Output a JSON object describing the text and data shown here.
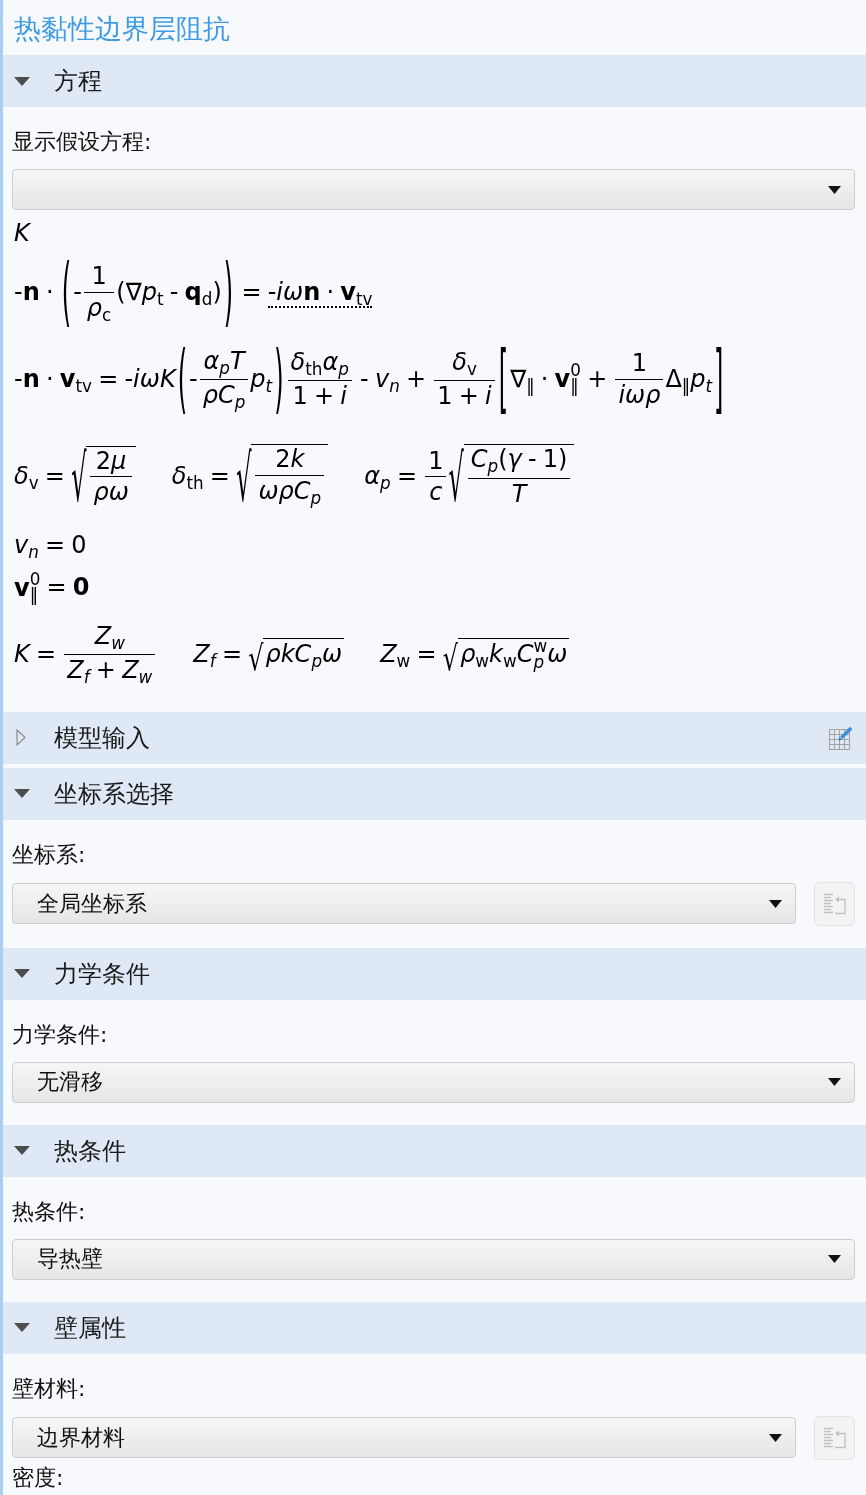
{
  "title": "热黏性边界层阻抗",
  "sections": [
    {
      "title": "方程",
      "expanded": true,
      "fields": [
        {
          "kind": "dropdown",
          "label": "显示假设方程:"
        }
      ],
      "equations": [
        {
          "parts": [
            [
              {
                "kind": "var",
                "text": "K"
              }
            ]
          ]
        },
        {
          "parts": [
            [
              {
                "kind": "op",
                "text": "-"
              },
              {
                "kind": "vec",
                "text": "n"
              },
              {
                "kind": "op",
                "text": " · "
              },
              {
                "kind": "fence",
                "open": "(",
                "close": ")",
                "body": [
                  {
                    "kind": "op",
                    "text": "-"
                  },
                  {
                    "kind": "frac",
                    "numerator": [
                      {
                        "kind": "op",
                        "text": "1"
                      }
                    ],
                    "denominator": [
                      {
                        "kind": "var",
                        "text": "ρ",
                        "sub": [
                          {
                            "kind": "op",
                            "text": "c"
                          }
                        ]
                      }
                    ]
                  },
                  {
                    "kind": "op",
                    "text": "(∇"
                  },
                  {
                    "kind": "var",
                    "text": "p",
                    "sub": [
                      {
                        "kind": "op",
                        "text": "t"
                      }
                    ]
                  },
                  {
                    "kind": "op",
                    "text": " - "
                  },
                  {
                    "kind": "vec",
                    "text": "q",
                    "sub": [
                      {
                        "kind": "op",
                        "text": "d"
                      }
                    ]
                  },
                  {
                    "kind": "op",
                    "text": ")"
                  }
                ]
              },
              {
                "kind": "op",
                "text": " = "
              },
              {
                "kind": "dotted",
                "body": [
                  {
                    "kind": "op",
                    "text": "-"
                  },
                  {
                    "kind": "var",
                    "text": "iω"
                  },
                  {
                    "kind": "vec",
                    "text": "n"
                  },
                  {
                    "kind": "op",
                    "text": " · "
                  },
                  {
                    "kind": "vec",
                    "text": "v",
                    "sub": [
                      {
                        "kind": "op",
                        "text": "tv"
                      }
                    ]
                  }
                ]
              }
            ]
          ]
        },
        {
          "parts": [
            [
              {
                "kind": "op",
                "text": "-"
              },
              {
                "kind": "vec",
                "text": "n"
              },
              {
                "kind": "op",
                "text": " · "
              },
              {
                "kind": "vec",
                "text": "v",
                "sub": [
                  {
                    "kind": "op",
                    "text": "tv"
                  }
                ]
              },
              {
                "kind": "op",
                "text": " = -"
              },
              {
                "kind": "var",
                "text": "iωK"
              },
              {
                "kind": "fence",
                "open": "(",
                "close": ")",
                "body": [
                  {
                    "kind": "op",
                    "text": "-"
                  },
                  {
                    "kind": "frac",
                    "numerator": [
                      {
                        "kind": "var",
                        "text": "α",
                        "sub": [
                          {
                            "kind": "var",
                            "text": "p"
                          }
                        ]
                      },
                      {
                        "kind": "var",
                        "text": "T"
                      }
                    ],
                    "denominator": [
                      {
                        "kind": "var",
                        "text": "ρC",
                        "sub": [
                          {
                            "kind": "var",
                            "text": "p"
                          }
                        ]
                      }
                    ]
                  },
                  {
                    "kind": "var",
                    "text": "p",
                    "sub": [
                      {
                        "kind": "var",
                        "text": "t"
                      }
                    ]
                  }
                ]
              },
              {
                "kind": "frac",
                "numerator": [
                  {
                    "kind": "var",
                    "text": "δ",
                    "sub": [
                      {
                        "kind": "op",
                        "text": "th"
                      }
                    ]
                  },
                  {
                    "kind": "var",
                    "text": "α",
                    "sub": [
                      {
                        "kind": "var",
                        "text": "p"
                      }
                    ]
                  }
                ],
                "denominator": [
                  {
                    "kind": "op",
                    "text": "1 + "
                  },
                  {
                    "kind": "var",
                    "text": "i"
                  }
                ]
              },
              {
                "kind": "op",
                "text": " - "
              },
              {
                "kind": "var",
                "text": "v",
                "sub": [
                  {
                    "kind": "var",
                    "text": "n"
                  }
                ]
              },
              {
                "kind": "op",
                "text": " + "
              },
              {
                "kind": "frac",
                "numerator": [
                  {
                    "kind": "var",
                    "text": "δ",
                    "sub": [
                      {
                        "kind": "op",
                        "text": "v"
                      }
                    ]
                  }
                ],
                "denominator": [
                  {
                    "kind": "op",
                    "text": "1 + "
                  },
                  {
                    "kind": "var",
                    "text": "i"
                  }
                ]
              },
              {
                "kind": "fence",
                "open": "[",
                "close": "]",
                "body": [
                  {
                    "kind": "op",
                    "text": "∇",
                    "sub": [
                      {
                        "kind": "op",
                        "text": "‖"
                      }
                    ]
                  },
                  {
                    "kind": "op",
                    "text": " · "
                  },
                  {
                    "kind": "vec",
                    "text": "v",
                    "sup": [
                      {
                        "kind": "op",
                        "text": "0"
                      }
                    ],
                    "sub": [
                      {
                        "kind": "op",
                        "text": "‖"
                      }
                    ]
                  },
                  {
                    "kind": "op",
                    "text": " + "
                  },
                  {
                    "kind": "frac",
                    "numerator": [
                      {
                        "kind": "op",
                        "text": "1"
                      }
                    ],
                    "denominator": [
                      {
                        "kind": "var",
                        "text": "iωρ"
                      }
                    ]
                  },
                  {
                    "kind": "op",
                    "text": "Δ",
                    "sub": [
                      {
                        "kind": "op",
                        "text": "‖"
                      }
                    ]
                  },
                  {
                    "kind": "var",
                    "text": "p",
                    "sub": [
                      {
                        "kind": "var",
                        "text": "t"
                      }
                    ]
                  }
                ]
              }
            ]
          ]
        },
        {
          "parts": [
            [
              {
                "kind": "var",
                "text": "δ",
                "sub": [
                  {
                    "kind": "op",
                    "text": "v"
                  }
                ]
              },
              {
                "kind": "op",
                "text": " = "
              },
              {
                "kind": "sqrt",
                "sign": "√",
                "body": [
                  {
                    "kind": "frac",
                    "numerator": [
                      {
                        "kind": "op",
                        "text": "2"
                      },
                      {
                        "kind": "var",
                        "text": "μ"
                      }
                    ],
                    "denominator": [
                      {
                        "kind": "var",
                        "text": "ρω"
                      }
                    ]
                  }
                ]
              }
            ],
            [
              {
                "kind": "var",
                "text": "δ",
                "sub": [
                  {
                    "kind": "op",
                    "text": "th"
                  }
                ]
              },
              {
                "kind": "op",
                "text": " = "
              },
              {
                "kind": "sqrt",
                "sign": "√",
                "body": [
                  {
                    "kind": "frac",
                    "numerator": [
                      {
                        "kind": "op",
                        "text": "2"
                      },
                      {
                        "kind": "var",
                        "text": "k"
                      }
                    ],
                    "denominator": [
                      {
                        "kind": "var",
                        "text": "ωρC",
                        "sub": [
                          {
                            "kind": "var",
                            "text": "p"
                          }
                        ]
                      }
                    ]
                  }
                ]
              }
            ],
            [
              {
                "kind": "var",
                "text": "α",
                "sub": [
                  {
                    "kind": "var",
                    "text": "p"
                  }
                ]
              },
              {
                "kind": "op",
                "text": " = "
              },
              {
                "kind": "frac",
                "numerator": [
                  {
                    "kind": "op",
                    "text": "1"
                  }
                ],
                "denominator": [
                  {
                    "kind": "var",
                    "text": "c"
                  }
                ]
              },
              {
                "kind": "sqrt",
                "sign": "√",
                "body": [
                  {
                    "kind": "frac",
                    "numerator": [
                      {
                        "kind": "var",
                        "text": "C",
                        "sub": [
                          {
                            "kind": "var",
                            "text": "p"
                          }
                        ]
                      },
                      {
                        "kind": "op",
                        "text": "("
                      },
                      {
                        "kind": "var",
                        "text": "γ"
                      },
                      {
                        "kind": "op",
                        "text": " - 1)"
                      }
                    ],
                    "denominator": [
                      {
                        "kind": "var",
                        "text": "T"
                      }
                    ]
                  }
                ]
              }
            ]
          ]
        },
        {
          "parts": [
            [
              {
                "kind": "var",
                "text": "v",
                "sub": [
                  {
                    "kind": "var",
                    "text": "n"
                  }
                ]
              },
              {
                "kind": "op",
                "text": " = 0"
              }
            ]
          ]
        },
        {
          "parts": [
            [
              {
                "kind": "vec",
                "text": "v",
                "sup": [
                  {
                    "kind": "op",
                    "text": "0"
                  }
                ],
                "sub": [
                  {
                    "kind": "op",
                    "text": "‖"
                  }
                ]
              },
              {
                "kind": "op",
                "text": " = "
              },
              {
                "kind": "vec",
                "text": "0"
              }
            ]
          ]
        },
        {
          "parts": [
            [
              {
                "kind": "var",
                "text": "K"
              },
              {
                "kind": "op",
                "text": " = "
              },
              {
                "kind": "frac",
                "numerator": [
                  {
                    "kind": "var",
                    "text": "Z",
                    "sub": [
                      {
                        "kind": "var",
                        "text": "w"
                      }
                    ]
                  }
                ],
                "denominator": [
                  {
                    "kind": "var",
                    "text": "Z",
                    "sub": [
                      {
                        "kind": "var",
                        "text": "f"
                      }
                    ]
                  },
                  {
                    "kind": "op",
                    "text": " + "
                  },
                  {
                    "kind": "var",
                    "text": "Z",
                    "sub": [
                      {
                        "kind": "var",
                        "text": "w"
                      }
                    ]
                  }
                ]
              }
            ],
            [
              {
                "kind": "var",
                "text": "Z",
                "sub": [
                  {
                    "kind": "var",
                    "text": "f"
                  }
                ]
              },
              {
                "kind": "op",
                "text": " = "
              },
              {
                "kind": "sqrt",
                "sign": "√",
                "body": [
                  {
                    "kind": "var",
                    "text": "ρkC",
                    "sub": [
                      {
                        "kind": "var",
                        "text": "p"
                      }
                    ]
                  },
                  {
                    "kind": "var",
                    "text": "ω"
                  }
                ]
              }
            ],
            [
              {
                "kind": "var",
                "text": "Z",
                "sub": [
                  {
                    "kind": "op",
                    "text": "w"
                  }
                ]
              },
              {
                "kind": "op",
                "text": " = "
              },
              {
                "kind": "sqrt",
                "sign": "√",
                "body": [
                  {
                    "kind": "var",
                    "text": "ρ",
                    "sub": [
                      {
                        "kind": "op",
                        "text": "w"
                      }
                    ]
                  },
                  {
                    "kind": "var",
                    "text": "k",
                    "sub": [
                      {
                        "kind": "op",
                        "text": "w"
                      }
                    ]
                  },
                  {
                    "kind": "var",
                    "text": "C",
                    "sup": [
                      {
                        "kind": "op",
                        "text": "w"
                      }
                    ],
                    "sub": [
                      {
                        "kind": "var",
                        "text": "p"
                      }
                    ]
                  },
                  {
                    "kind": "var",
                    "text": "ω"
                  }
                ]
              }
            ]
          ]
        }
      ]
    },
    {
      "title": "模型输入",
      "expanded": false,
      "edit_button": true
    },
    {
      "title": "坐标系选择",
      "expanded": true,
      "fields": [
        {
          "kind": "dropdown",
          "label": "坐标系:",
          "value": "全局坐标系",
          "side_button": {
            "disabled": true
          }
        }
      ]
    },
    {
      "title": "力学条件",
      "expanded": true,
      "fields": [
        {
          "kind": "dropdown",
          "label": "力学条件:",
          "value": "无滑移"
        }
      ]
    },
    {
      "title": "热条件",
      "expanded": true,
      "fields": [
        {
          "kind": "dropdown",
          "label": "热条件:",
          "value": "导热壁"
        }
      ]
    },
    {
      "title": "壁属性",
      "expanded": true,
      "fields": [
        {
          "kind": "dropdown",
          "label": "壁材料:",
          "value": "边界材料",
          "side_button": {
            "disabled": true
          }
        },
        {
          "kind": "label",
          "label": "密度:"
        }
      ]
    }
  ]
}
